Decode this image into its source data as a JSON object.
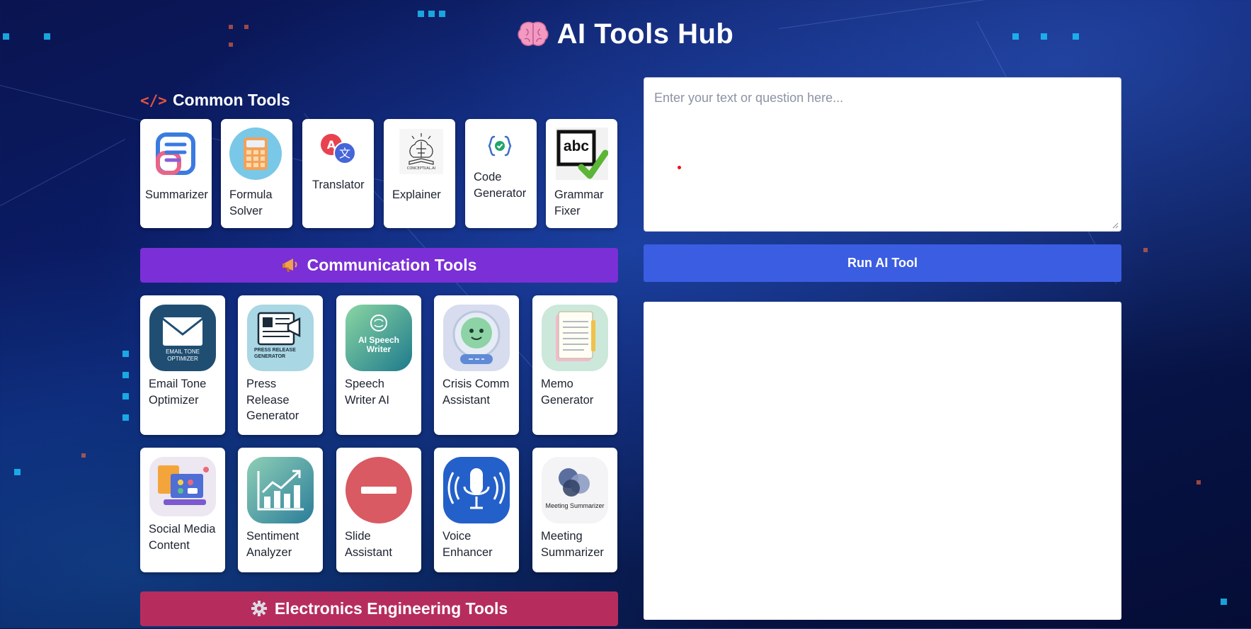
{
  "app": {
    "title": "AI Tools Hub",
    "title_icon": "brain-icon"
  },
  "common": {
    "heading": "Common Tools",
    "heading_icon": "code-brackets-icon",
    "tools": [
      {
        "label": "Summarizer",
        "icon": "summarizer-icon"
      },
      {
        "label": "Formula Solver",
        "icon": "calculator-icon"
      },
      {
        "label": "Translator",
        "icon": "translate-icon"
      },
      {
        "label": "Explainer",
        "icon": "conceptual-ai-icon",
        "icon_text": "CONCEPTUAL.AI"
      },
      {
        "label": "Code Generator",
        "icon": "code-check-icon"
      },
      {
        "label": "Grammar Fixer",
        "icon": "abc-check-icon",
        "icon_text": "abc"
      }
    ]
  },
  "communication": {
    "heading": "Communication Tools",
    "heading_icon": "megaphone-icon",
    "color": "#7b2fd6",
    "tools": [
      {
        "label": "Email Tone Optimizer",
        "icon": "email-icon",
        "icon_text": "EMAIL TONE OPTIMIZER"
      },
      {
        "label": "Press Release Generator",
        "icon": "press-release-icon",
        "icon_text": "PRESS RELEASE GENERATOR"
      },
      {
        "label": "Speech Writer AI",
        "icon": "speech-writer-icon",
        "icon_text": "AI Speech Writer"
      },
      {
        "label": "Crisis Comm Assistant",
        "icon": "astronaut-icon"
      },
      {
        "label": "Memo Generator",
        "icon": "notepad-icon"
      },
      {
        "label": "Social Media Content",
        "icon": "social-media-icon"
      },
      {
        "label": "Sentiment Analyzer",
        "icon": "bar-chart-icon"
      },
      {
        "label": "Slide Assistant",
        "icon": "minus-circle-icon"
      },
      {
        "label": "Voice Enhancer",
        "icon": "microphone-icon"
      },
      {
        "label": "Meeting Summarizer",
        "icon": "meeting-icon",
        "icon_text": "Meeting Summarizer"
      }
    ]
  },
  "electronics": {
    "heading": "Electronics Engineering Tools",
    "heading_icon": "gear-icon",
    "color": "#b62d5d"
  },
  "input": {
    "placeholder": "Enter your text or question here..."
  },
  "run_button": {
    "label": "Run AI Tool",
    "color": "#3b5de2"
  },
  "output": {
    "text": ""
  }
}
